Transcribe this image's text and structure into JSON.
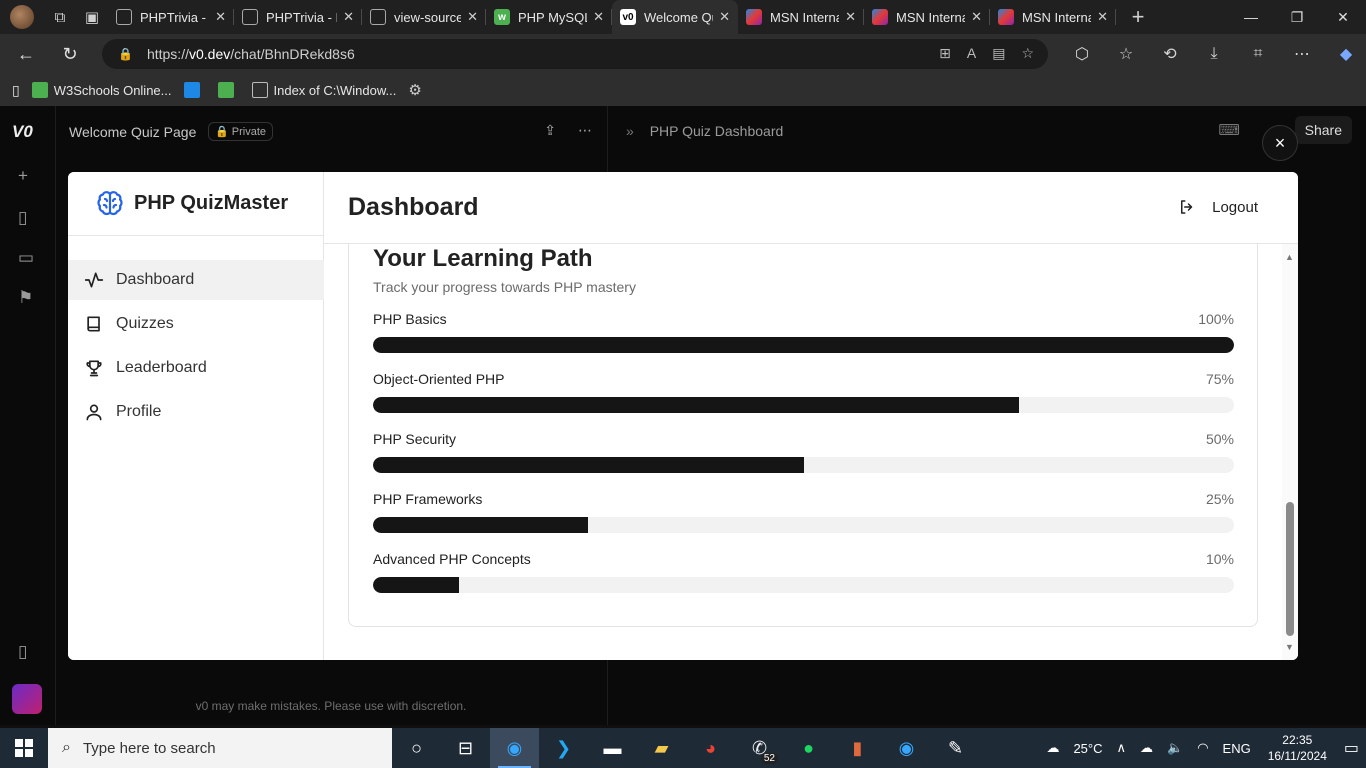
{
  "browser": {
    "tabs": [
      {
        "label": "PHPTrivia - D",
        "icon": "page-icon",
        "active": false
      },
      {
        "label": "PHPTrivia - D",
        "icon": "page-icon",
        "active": false
      },
      {
        "label": "view-source:",
        "icon": "page-icon",
        "active": false
      },
      {
        "label": "PHP MySQL",
        "icon": "w3schools-icon",
        "active": false
      },
      {
        "label": "Welcome Qu",
        "icon": "v0-icon",
        "active": true
      },
      {
        "label": "MSN Interna",
        "icon": "msn-icon",
        "active": false
      },
      {
        "label": "MSN Interna",
        "icon": "msn-icon",
        "active": false
      },
      {
        "label": "MSN Interna",
        "icon": "msn-icon",
        "active": false
      }
    ],
    "url_prefix": "https://",
    "url_host": "v0.dev",
    "url_path": "/chat/BhnDRekd8s6",
    "favorites": [
      {
        "label": "W3Schools Online..."
      },
      {
        "label": ""
      },
      {
        "label": ""
      },
      {
        "label": "Index of C:\\Window..."
      }
    ]
  },
  "v0": {
    "chat_title": "Welcome Quiz Page",
    "private_label": "Private",
    "disclaimer": "v0 may make mistakes. Please use with discretion.",
    "preview_title": "PHP Quiz Dashboard",
    "share_label": "Share",
    "close_label": "×"
  },
  "app": {
    "brand": "PHP QuizMaster",
    "nav": [
      {
        "label": "Dashboard",
        "icon": "activity-icon",
        "active": true
      },
      {
        "label": "Quizzes",
        "icon": "book-icon",
        "active": false
      },
      {
        "label": "Leaderboard",
        "icon": "trophy-icon",
        "active": false
      },
      {
        "label": "Profile",
        "icon": "user-icon",
        "active": false
      }
    ],
    "page_title": "Dashboard",
    "logout_label": "Logout",
    "learning_path": {
      "title": "Your Learning Path",
      "subtitle": "Track your progress towards PHP mastery",
      "items": [
        {
          "name": "PHP Basics",
          "percent_label": "100%",
          "value": 100
        },
        {
          "name": "Object-Oriented PHP",
          "percent_label": "75%",
          "value": 75
        },
        {
          "name": "PHP Security",
          "percent_label": "50%",
          "value": 50
        },
        {
          "name": "PHP Frameworks",
          "percent_label": "25%",
          "value": 25
        },
        {
          "name": "Advanced PHP Concepts",
          "percent_label": "10%",
          "value": 10
        }
      ]
    }
  },
  "taskbar": {
    "search_placeholder": "Type here to search",
    "whatsapp_badge": "52",
    "weather": "25°C",
    "language": "ENG",
    "time": "22:35",
    "date": "16/11/2024"
  },
  "colors": {
    "progress_fill": "#151515",
    "progress_track": "#f2f2f2",
    "accent_brand": "#2563eb"
  }
}
